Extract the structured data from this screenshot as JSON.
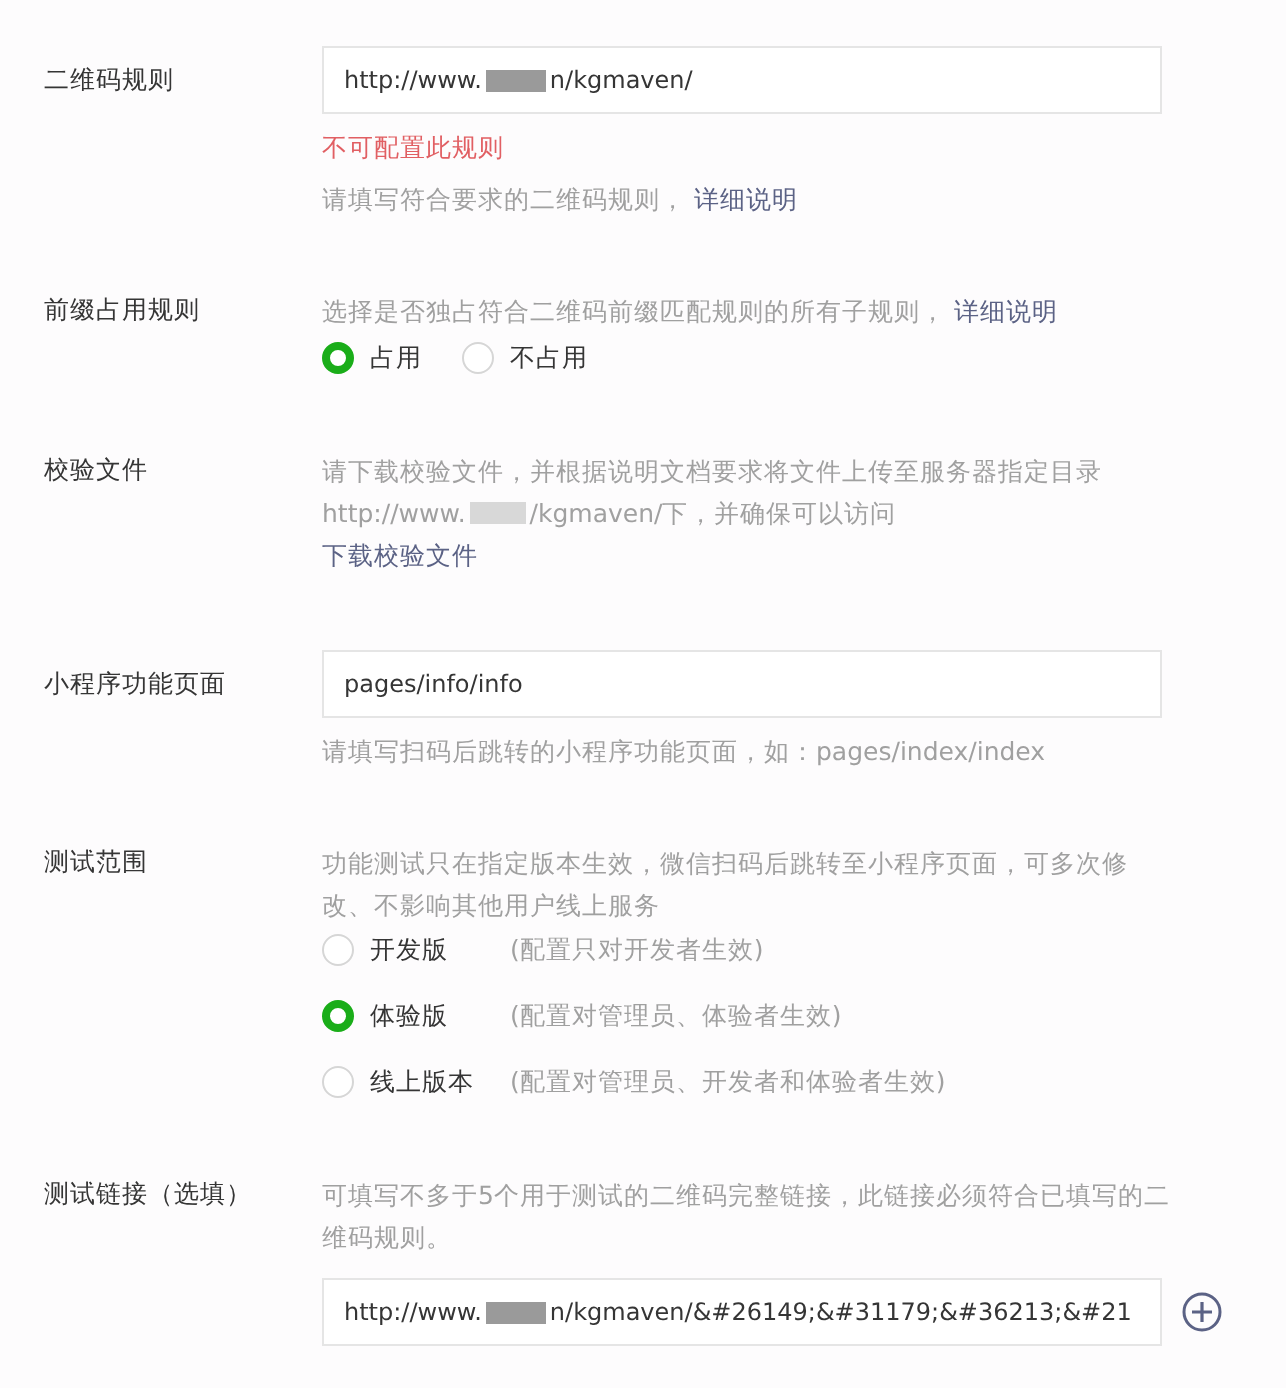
{
  "rows": [
    {
      "label": "二维码规则",
      "kind": "field",
      "field": {
        "prefix": "http://www.",
        "obscured": true,
        "suffix": "n/kgmaven/"
      },
      "error": "不可配置此规则",
      "help_after": "请填写符合要求的二维码规则，",
      "help_link": "详细说明"
    },
    {
      "label": "前缀占用规则",
      "kind": "radio-inline",
      "help": [
        "选择是否独占符合二维码前缀匹配规则的所有子规则，"
      ],
      "help_link": "详细说明",
      "options": [
        {
          "label": "占用",
          "selected": true
        },
        {
          "label": "不占用",
          "selected": false
        }
      ]
    },
    {
      "label": "校验文件",
      "kind": "text",
      "help": [
        "请下载校验文件，并根据说明文档要求将文件上传至服务器指定目录"
      ],
      "url": {
        "prefix": "http://www.",
        "obscured": true,
        "suffix": "/kgmaven/下，并确保可以访问"
      },
      "link": "下载校验文件"
    },
    {
      "label": "小程序功能页面",
      "kind": "field",
      "field": {
        "prefix": "pages/info/info"
      },
      "help_after": "请填写扫码后跳转的小程序功能页面，如：pages/index/index"
    },
    {
      "label": "测试范围",
      "kind": "radio-list",
      "help": [
        "功能测试只在指定版本生效，微信扫码后跳转至小程序页面，可多次修改、不影响其他用户线上服务"
      ],
      "options": [
        {
          "label": "开发版",
          "note": "(配置只对开发者生效)",
          "selected": false
        },
        {
          "label": "体验版",
          "note": "(配置对管理员、体验者生效)",
          "selected": true
        },
        {
          "label": "线上版本",
          "note": "(配置对管理员、开发者和体验者生效)",
          "selected": false
        }
      ]
    },
    {
      "label": "测试链接（选填）",
      "kind": "help-field",
      "help": [
        "可填写不多于5个用于测试的二维码完整链接，此链接必须符合已填写的二维码规则。"
      ],
      "field": {
        "prefix": "http://www.",
        "obscured": true,
        "suffix": "n/kgmaven/&#26149;&#31179;&#36213;&#21"
      },
      "add_button": true
    }
  ]
}
